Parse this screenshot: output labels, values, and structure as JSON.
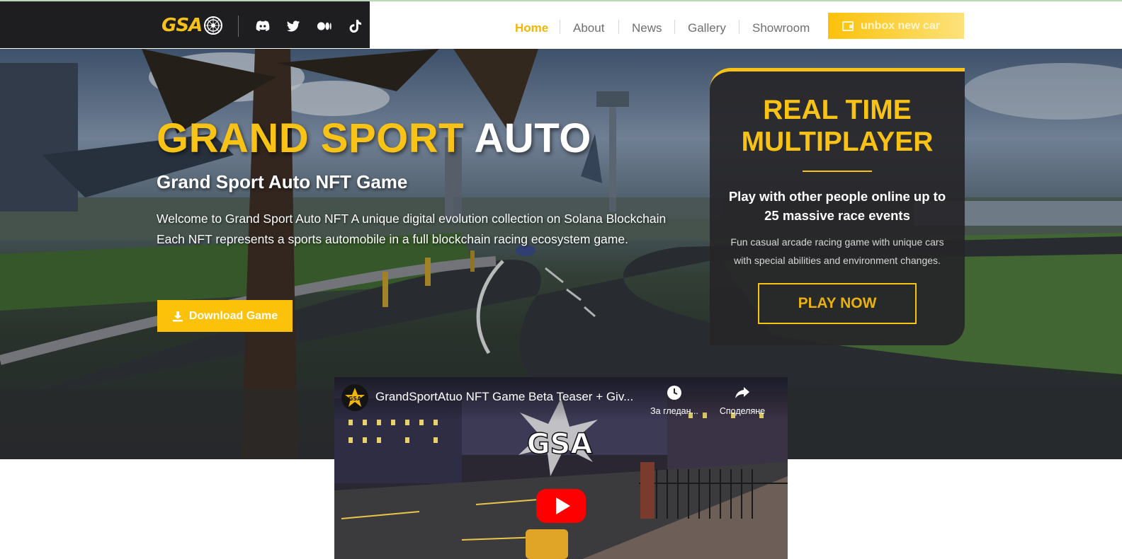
{
  "brand": {
    "logo_text": "GSA",
    "colors": {
      "accent": "#f8c315",
      "dark": "#1e1e20"
    }
  },
  "social": [
    {
      "name": "discord-icon"
    },
    {
      "name": "twitter-icon"
    },
    {
      "name": "medium-icon"
    },
    {
      "name": "tiktok-icon"
    }
  ],
  "nav": {
    "items": [
      {
        "label": "Home",
        "active": true
      },
      {
        "label": "About",
        "active": false
      },
      {
        "label": "News",
        "active": false
      },
      {
        "label": "Gallery",
        "active": false
      },
      {
        "label": "Showroom",
        "active": false
      }
    ],
    "cta_label": "unbox new car",
    "cta_icon": "wallet-icon"
  },
  "hero": {
    "title_part1": "GRAND SPORT",
    "title_part2": "AUTO",
    "subtitle": "Grand Sport Auto NFT Game",
    "description_line1": "Welcome to Grand Sport Auto NFT A unique digital evolution collection on Solana Blockchain",
    "description_line2": "Each NFT represents a sports automobile in a full blockchain racing ecosystem game.",
    "download_label": "Download Game",
    "download_icon": "download-icon"
  },
  "multiplayer_card": {
    "title_line1": "REAL TIME",
    "title_line2": "MULTIPLAYER",
    "subtitle_line1": "Play with other people online up to",
    "subtitle_line2": "25 massive race events",
    "description_line1": "Fun casual arcade racing game with unique cars",
    "description_line2": "with special abilities and environment changes.",
    "play_label": "PLAY NOW"
  },
  "video": {
    "title": "GrandSportAtuo NFT Game Beta Teaser + Giv...",
    "channel_logo_text": "GSA",
    "watch_later_label": "За гледан...",
    "share_label": "Споделяне",
    "overlay_logo_text": "GSA"
  }
}
